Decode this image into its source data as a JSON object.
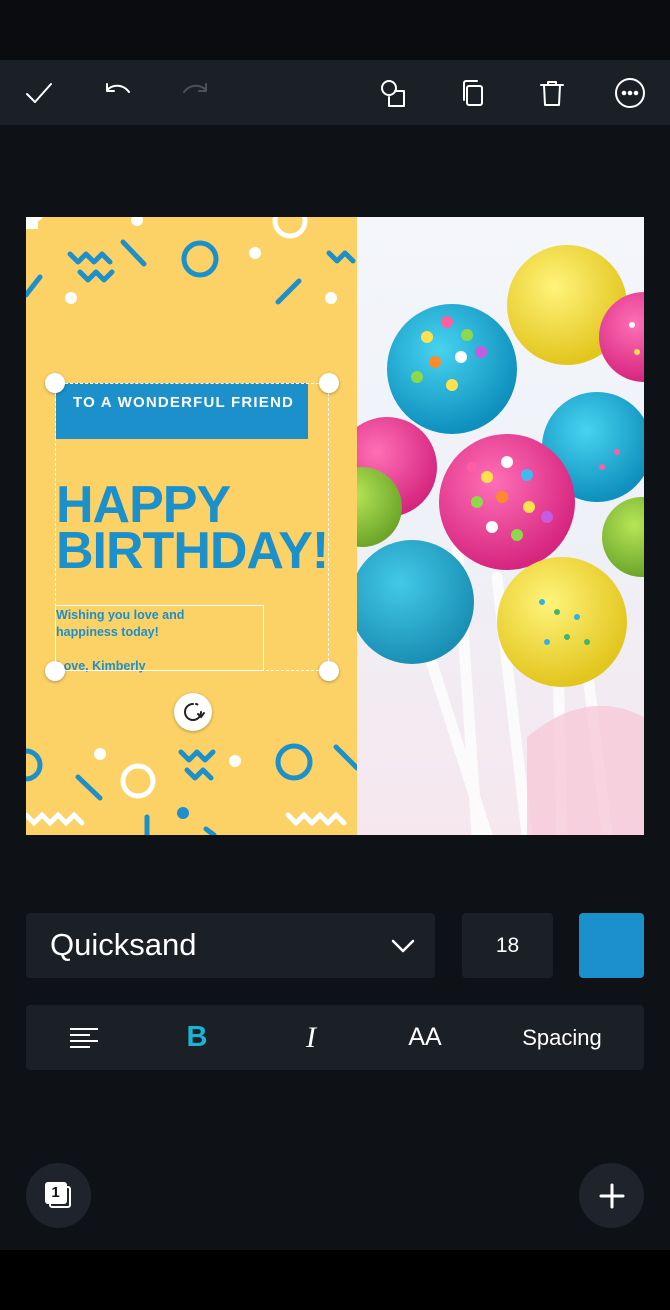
{
  "toolbar": {
    "done_icon": "check-icon",
    "undo_icon": "undo-icon",
    "redo_icon": "redo-icon",
    "shapes_icon": "shapes-icon",
    "duplicate_icon": "duplicate-icon",
    "delete_icon": "trash-icon",
    "more_icon": "more-icon"
  },
  "card": {
    "banner_text": "TO A WONDERFUL FRIEND",
    "headline": "HAPPY BIRTHDAY!",
    "message": "Wishing you love and\nhappiness today!\n\nLove, Kimberly",
    "background_color": "#fcd166",
    "accent_color": "#1b90cb"
  },
  "text_controls": {
    "font_name": "Quicksand",
    "font_size": "18",
    "text_color": "#1b90cb",
    "bold_label": "B",
    "italic_label": "I",
    "case_label": "AA",
    "spacing_label": "Spacing"
  },
  "pages": {
    "current_page": "1"
  }
}
